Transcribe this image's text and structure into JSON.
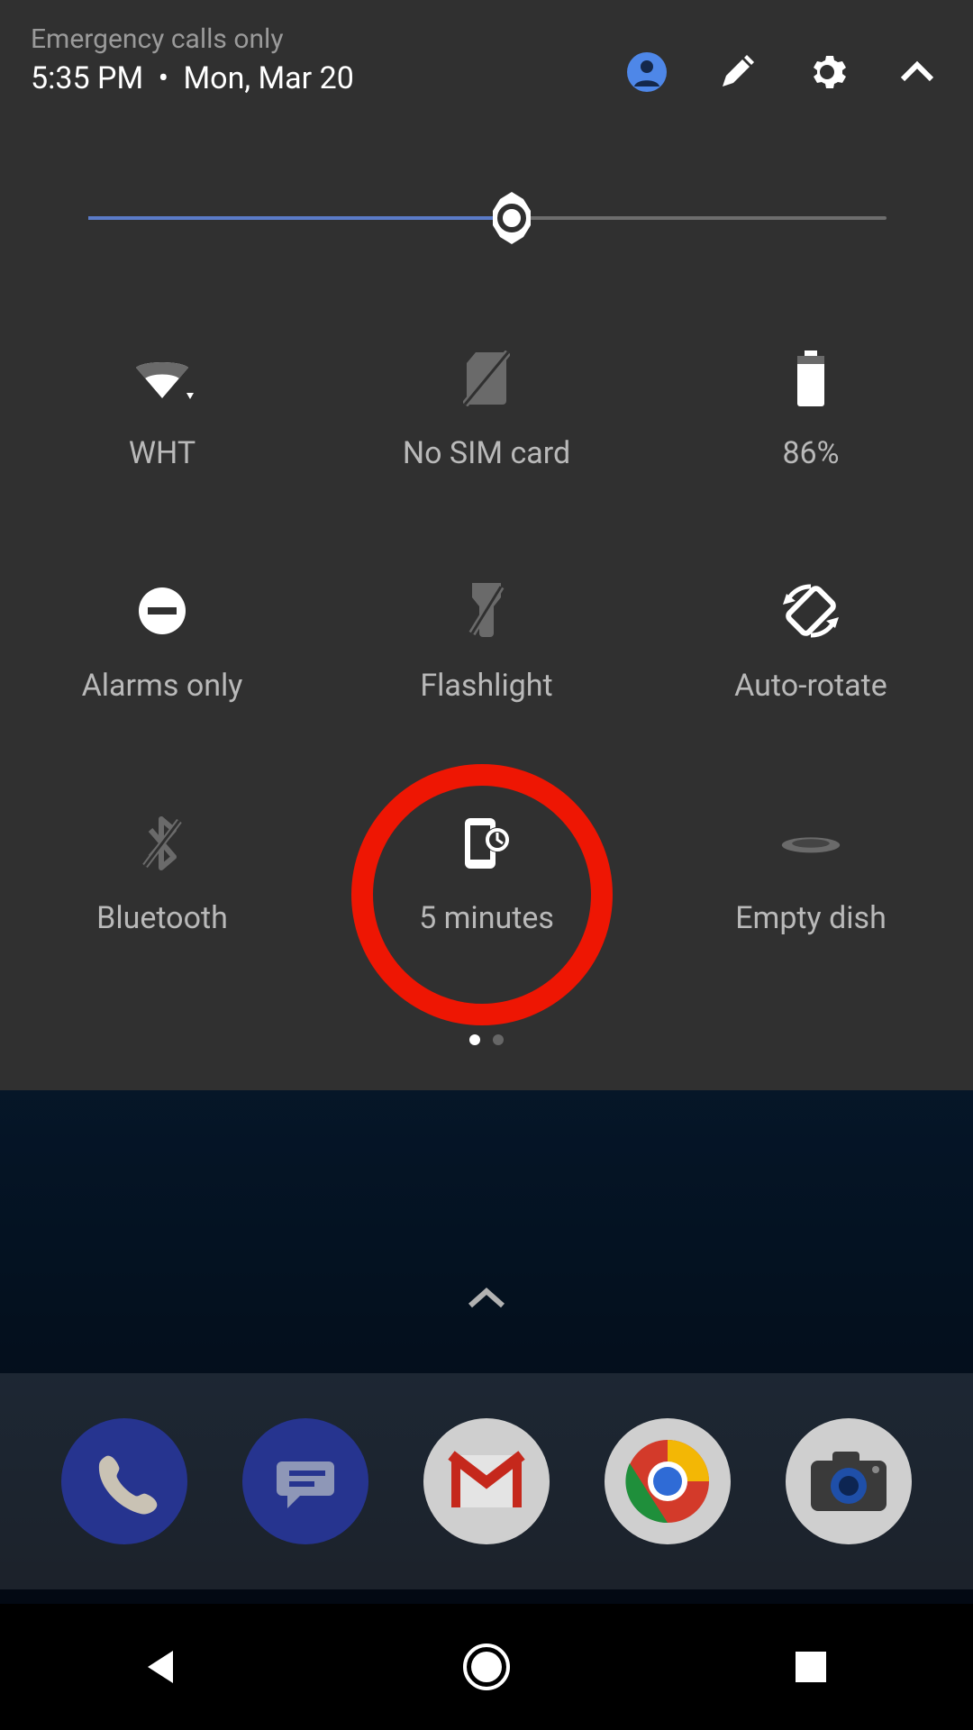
{
  "status": {
    "emergency_text": "Emergency calls only",
    "time": "5:35 PM",
    "separator": "•",
    "date": "Mon, Mar 20"
  },
  "header_icons": {
    "user": "user-icon",
    "edit": "edit-icon",
    "settings": "settings-icon",
    "collapse": "chevron-up-icon"
  },
  "brightness": {
    "percent": 53
  },
  "tiles": [
    {
      "label": "WHT",
      "icon": "wifi-icon",
      "active": true
    },
    {
      "label": "No SIM card",
      "icon": "no-sim-icon",
      "active": false
    },
    {
      "label": "86%",
      "icon": "battery-icon",
      "active": true
    },
    {
      "label": "Alarms only",
      "icon": "dnd-icon",
      "active": true
    },
    {
      "label": "Flashlight",
      "icon": "flashlight-icon",
      "active": false
    },
    {
      "label": "Auto-rotate",
      "icon": "auto-rotate-icon",
      "active": true
    },
    {
      "label": "Bluetooth",
      "icon": "bluetooth-icon",
      "active": false
    },
    {
      "label": "5 minutes",
      "icon": "screen-lock-icon",
      "active": true
    },
    {
      "label": "Empty dish",
      "icon": "dish-icon",
      "active": false
    }
  ],
  "highlighted_tile_index": 7,
  "page_indicator": {
    "total": 2,
    "active": 0
  },
  "dock": [
    {
      "name": "phone-app",
      "color": "#3949ab"
    },
    {
      "name": "messages-app",
      "color": "#3949ab"
    },
    {
      "name": "gmail-app",
      "color": "#d9d9d9"
    },
    {
      "name": "chrome-app",
      "color": "#d9d9d9"
    },
    {
      "name": "camera-app",
      "color": "#d9d9d9"
    }
  ],
  "colors": {
    "accent": "#4e87e8",
    "track": "#5b7bc8",
    "ring": "#ee1603"
  }
}
